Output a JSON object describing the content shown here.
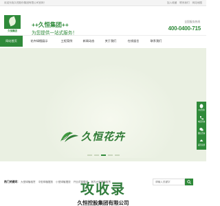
{
  "topbar": {
    "welcome": "欢迎光临久恒股份集团有限公司官网！",
    "links": [
      "加入收藏",
      "联系我们",
      "网站地图"
    ]
  },
  "header": {
    "logo_text": "久恒集团",
    "brand": "++久恒集团++",
    "slogan": "为您提供一站式服务！",
    "hotline_label": "全国服务热线",
    "hotline": "400-0400-715"
  },
  "nav": {
    "items": [
      "网站首页",
      "花卉绿植展示",
      "工程案例",
      "新闻动态",
      "关于我们",
      "在线留言",
      "联系我们"
    ],
    "active_index": 0
  },
  "banner": {
    "calligraphy": "久恒花卉",
    "slides": 5,
    "active_slide": 2
  },
  "side_tools": {
    "items": [
      {
        "icon": "qq-icon",
        "label": "QQ咨询"
      },
      {
        "icon": "phone-icon",
        "label": "电话咨询"
      },
      {
        "icon": "wechat-icon",
        "label": "微信咨询"
      },
      {
        "icon": "top-icon",
        "label": "返回顶部"
      }
    ]
  },
  "hotwords": {
    "title": "热门关键词：",
    "links": [
      "大型绿植租赁",
      "中型绿植摆放",
      "小型绿植摆放",
      "开业花篮赠送",
      "室内大型绿植租赁"
    ]
  },
  "search": {
    "placeholder": "请输入关键字"
  },
  "footer": {
    "company": "久恒控股集团有限公司"
  },
  "watermark": {
    "text": "攻收录"
  },
  "colors": {
    "brand_green": "#2f8a3a",
    "banner_bg": "#eaf0e2"
  }
}
